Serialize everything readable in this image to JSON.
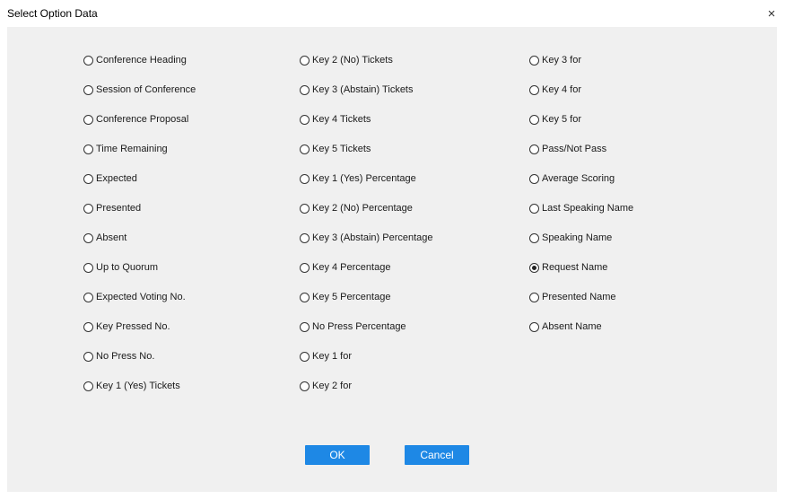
{
  "window": {
    "title": "Select Option Data",
    "close_glyph": "×"
  },
  "columns": [
    [
      {
        "label": "Conference Heading",
        "selected": false
      },
      {
        "label": "Session of Conference",
        "selected": false
      },
      {
        "label": "Conference Proposal",
        "selected": false
      },
      {
        "label": "Time Remaining",
        "selected": false
      },
      {
        "label": "Expected",
        "selected": false
      },
      {
        "label": "Presented",
        "selected": false
      },
      {
        "label": "Absent",
        "selected": false
      },
      {
        "label": "Up to Quorum",
        "selected": false
      },
      {
        "label": "Expected Voting No.",
        "selected": false
      },
      {
        "label": "Key Pressed No.",
        "selected": false
      },
      {
        "label": "No Press No.",
        "selected": false
      },
      {
        "label": "Key 1 (Yes) Tickets",
        "selected": false
      }
    ],
    [
      {
        "label": "Key 2 (No) Tickets",
        "selected": false
      },
      {
        "label": "Key 3 (Abstain) Tickets",
        "selected": false
      },
      {
        "label": "Key 4 Tickets",
        "selected": false
      },
      {
        "label": "Key 5 Tickets",
        "selected": false
      },
      {
        "label": "Key 1 (Yes)  Percentage",
        "selected": false
      },
      {
        "label": "Key 2 (No)  Percentage",
        "selected": false
      },
      {
        "label": "Key 3 (Abstain)  Percentage",
        "selected": false
      },
      {
        "label": "Key 4 Percentage",
        "selected": false
      },
      {
        "label": "Key 5 Percentage",
        "selected": false
      },
      {
        "label": "No Press Percentage",
        "selected": false
      },
      {
        "label": "Key 1 for",
        "selected": false
      },
      {
        "label": "Key 2 for",
        "selected": false
      }
    ],
    [
      {
        "label": "Key 3 for",
        "selected": false
      },
      {
        "label": "Key 4 for",
        "selected": false
      },
      {
        "label": "Key 5 for",
        "selected": false
      },
      {
        "label": "Pass/Not Pass",
        "selected": false
      },
      {
        "label": "Average Scoring",
        "selected": false
      },
      {
        "label": "Last Speaking Name",
        "selected": false
      },
      {
        "label": "Speaking Name",
        "selected": false
      },
      {
        "label": "Request Name",
        "selected": true
      },
      {
        "label": "Presented Name",
        "selected": false
      },
      {
        "label": "Absent Name",
        "selected": false
      }
    ]
  ],
  "buttons": {
    "ok": "OK",
    "cancel": "Cancel"
  },
  "colors": {
    "button_bg": "#1e88e5",
    "panel_bg": "#f0f0f0"
  }
}
